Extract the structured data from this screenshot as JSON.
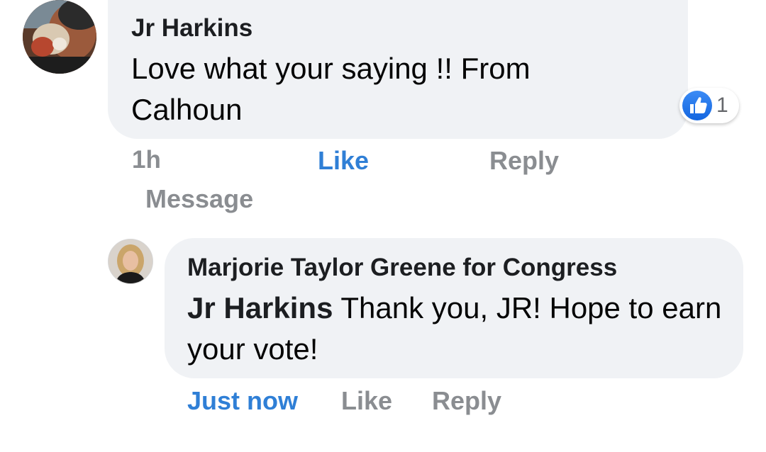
{
  "comment": {
    "author": "Jr Harkins",
    "text": "Love what your saying !! From Calhoun",
    "time": "1h",
    "like_label": "Like",
    "reply_label": "Reply",
    "message_label": "Message",
    "reaction_count": "1",
    "reaction_icon": "thumbs-up-icon"
  },
  "reply": {
    "author": "Marjorie Taylor Greene for Congress",
    "mention": "Jr Harkins",
    "text": " Thank you, JR! Hope to earn your vote!",
    "time": "Just now",
    "like_label": "Like",
    "reply_label": "Reply"
  },
  "colors": {
    "bubble": "#f0f2f5",
    "link_blue": "#2f7fd6",
    "muted": "#8a8d91",
    "text": "#050505"
  }
}
